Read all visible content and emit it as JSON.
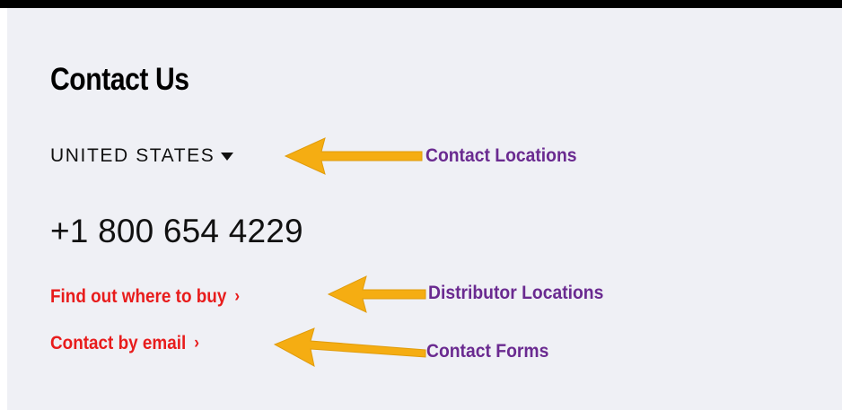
{
  "page": {
    "heading": "Contact Us",
    "country": {
      "selected": "UNITED STATES",
      "caret_icon": "caret-down-icon"
    },
    "phone": "+1 800 654 4229",
    "links": [
      {
        "label": "Find out where to buy",
        "chevron": "›"
      },
      {
        "label": "Contact by email",
        "chevron": "›"
      }
    ]
  },
  "annotations": [
    {
      "label": "Contact Locations",
      "arrow_icon": "left-arrow-icon"
    },
    {
      "label": "Distributor Locations",
      "arrow_icon": "left-arrow-icon"
    },
    {
      "label": "Contact Forms",
      "arrow_icon": "left-arrow-icon"
    }
  ],
  "colors": {
    "background": "#eff0f5",
    "top_bar": "#000000",
    "link_red": "#e81c1c",
    "annotation_purple": "#6a2a90",
    "arrow_orange": "#f5ad12",
    "text_dark": "#111111"
  }
}
